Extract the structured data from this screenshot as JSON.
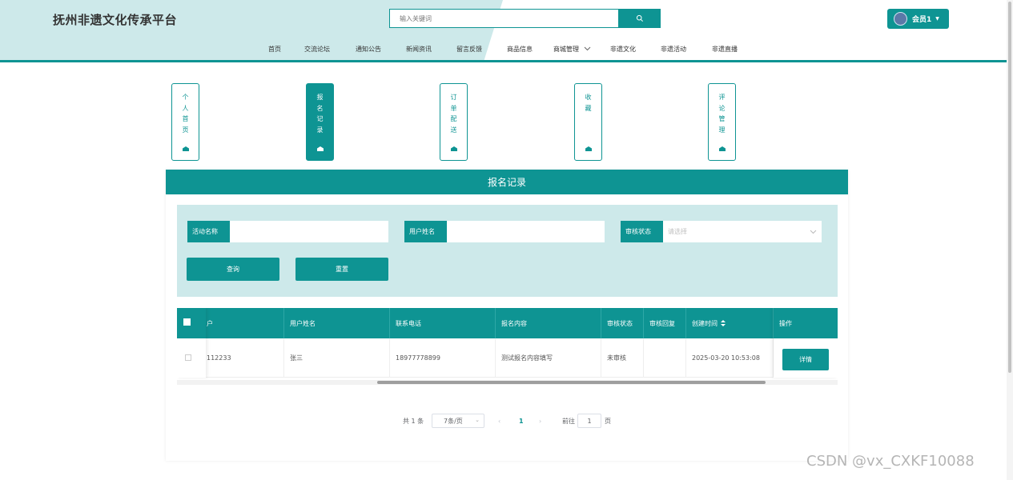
{
  "site_title": "抚州非遗文化传承平台",
  "search": {
    "placeholder": "输入关键词"
  },
  "member": {
    "label": "会员1"
  },
  "nav": [
    "首页",
    "交流论坛",
    "通知公告",
    "新闻资讯",
    "留言反馈",
    "商品信息",
    "商城管理",
    "非遗文化",
    "非遗活动",
    "非遗直播"
  ],
  "tabs": [
    {
      "label": "个人首页",
      "chars": [
        "个",
        "人",
        "首",
        "页"
      ]
    },
    {
      "label": "报名记录",
      "chars": [
        "报",
        "名",
        "记",
        "录"
      ]
    },
    {
      "label": "订单配送",
      "chars": [
        "订",
        "单",
        "配",
        "送"
      ]
    },
    {
      "label": "收藏",
      "chars": [
        "收",
        "藏"
      ]
    },
    {
      "label": "评论管理",
      "chars": [
        "评",
        "论",
        "管",
        "理"
      ]
    }
  ],
  "panel_title": "报名记录",
  "filter": {
    "activity_label": "活动名称",
    "username_label": "用户姓名",
    "status_label": "审核状态",
    "status_placeholder": "请选择",
    "query_button": "查询",
    "reset_button": "重置"
  },
  "table": {
    "headers": [
      "户",
      "用户姓名",
      "联系电话",
      "报名内容",
      "审核状态",
      "审核回复",
      "创建时间",
      "操作"
    ],
    "rows": [
      [
        "112233",
        "张三",
        "18977778899",
        "测试报名内容填写",
        "未审核",
        "",
        "2025-03-20 10:53:08",
        "详情"
      ]
    ]
  },
  "pagination": {
    "total": "共 1 条",
    "page_size": "7条/页",
    "current_page": "1",
    "goto_label": "前往",
    "goto_value": "1",
    "page_unit": "页"
  },
  "watermark": "CSDN @vx_CXKF10088"
}
